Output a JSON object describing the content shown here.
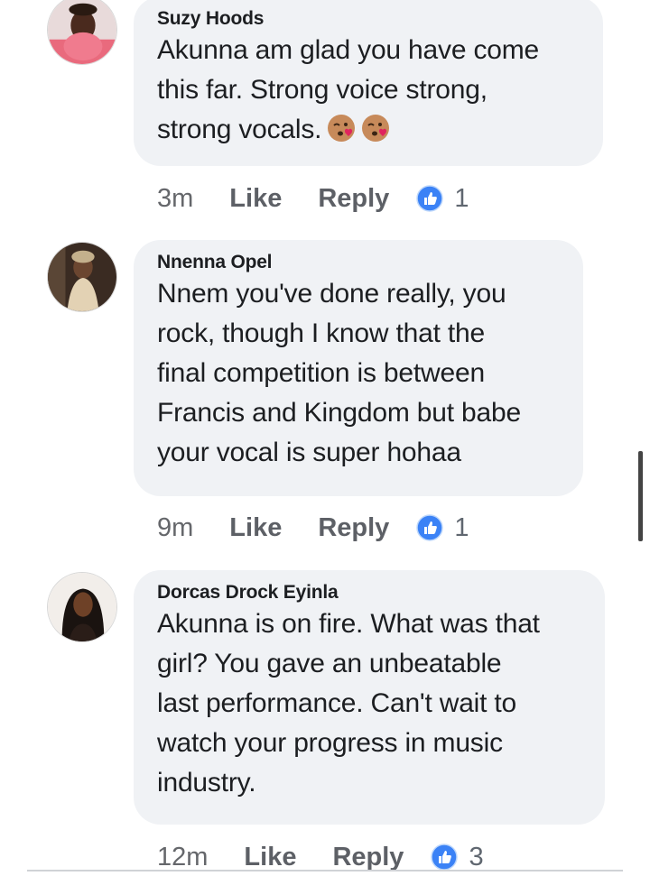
{
  "comments": [
    {
      "author": "Suzy Hoods",
      "lines": [
        "Akunna am glad you have come",
        "this far. Strong voice strong,",
        "strong vocals."
      ],
      "emoji": [
        "kissing-face-icon",
        "kissing-face-icon"
      ],
      "time": "3m",
      "like_label": "Like",
      "reply_label": "Reply",
      "reaction_count": "1"
    },
    {
      "author": "Nnenna Opel",
      "lines": [
        "Nnem you've done really, you",
        "rock, though I know that the",
        "final competition is between",
        "Francis and Kingdom but babe",
        "your vocal is super hohaa"
      ],
      "time": "9m",
      "like_label": "Like",
      "reply_label": "Reply",
      "reaction_count": "1"
    },
    {
      "author": "Dorcas Drock Eyinla",
      "lines": [
        "Akunna is on fire. What was that",
        "girl? You gave an unbeatable",
        "last performance. Can't wait to",
        "watch your progress in music",
        "industry."
      ],
      "time": "12m",
      "like_label": "Like",
      "reply_label": "Reply",
      "reaction_count": "3"
    }
  ],
  "colors": {
    "bubble": "#f0f2f5",
    "like_blue": "#1877f2",
    "meta_text": "#65676b"
  }
}
